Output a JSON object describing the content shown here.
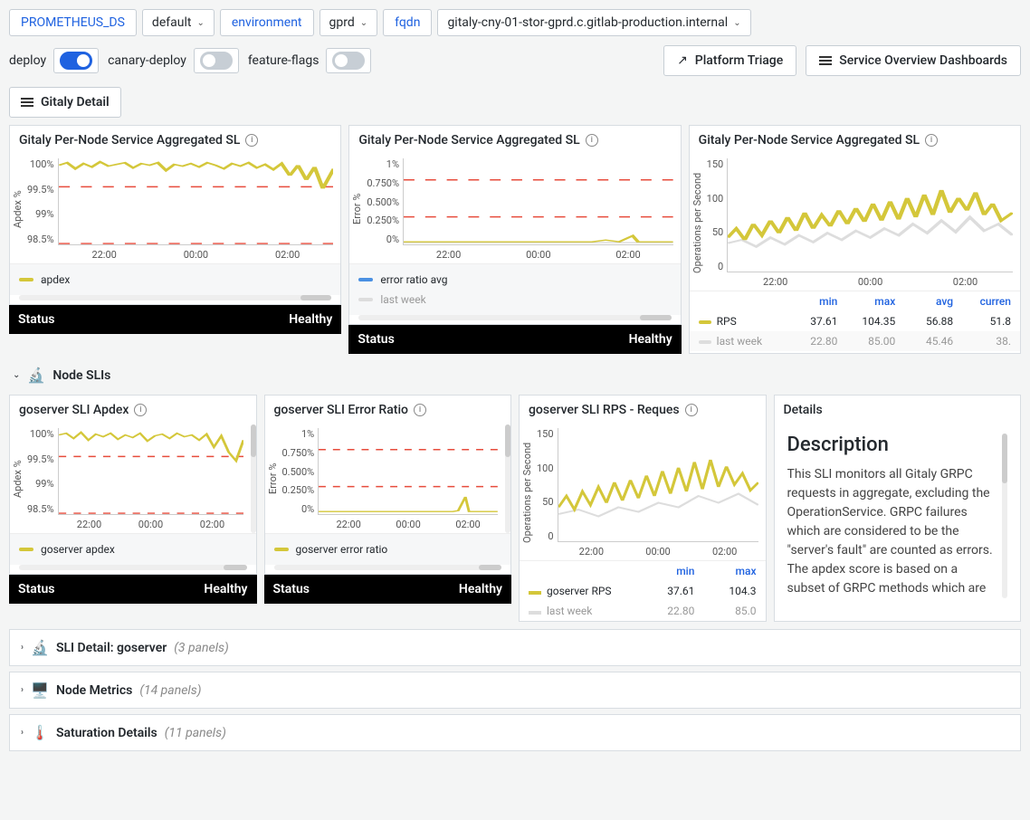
{
  "top_vars": {
    "prometheus_ds_label": "PROMETHEUS_DS",
    "prometheus_ds_value": "default",
    "environment_label": "environment",
    "environment_value": "gprd",
    "fqdn_label": "fqdn",
    "fqdn_value": "gitaly-cny-01-stor-gprd.c.gitlab-production.internal"
  },
  "toggles": {
    "deploy": "deploy",
    "canary_deploy": "canary-deploy",
    "feature_flags": "feature-flags"
  },
  "buttons": {
    "platform_triage": "Platform Triage",
    "service_overview": "Service Overview Dashboards",
    "gitaly_detail": "Gitaly Detail"
  },
  "sections": {
    "node_slis": "Node SLIs"
  },
  "collapsed": [
    {
      "emoji": "🔬",
      "title": "SLI Detail: goserver",
      "count": "(3 panels)"
    },
    {
      "emoji": "🖥️",
      "title": "Node Metrics",
      "count": "(14 panels)"
    },
    {
      "emoji": "🌡️",
      "title": "Saturation Details",
      "count": "(11 panels)"
    }
  ],
  "status": {
    "label": "Status",
    "value": "Healthy"
  },
  "x_ticks": [
    "22:00",
    "00:00",
    "02:00"
  ],
  "colors": {
    "yellow": "#d4c73a",
    "grey": "#cccccc",
    "blue": "#4a90e2",
    "red": "#e74c3c"
  },
  "panels_top": {
    "apdex": {
      "title": "Gitaly Per-Node Service Aggregated SL",
      "y_label": "Apdex %",
      "y_ticks": [
        "100%",
        "99.5%",
        "99%",
        "98.5%"
      ],
      "legend": [
        {
          "color": "yellow",
          "label": "apdex"
        }
      ]
    },
    "error": {
      "title": "Gitaly Per-Node Service Aggregated SL",
      "y_label": "Error %",
      "y_ticks": [
        "1%",
        "0.750%",
        "0.500%",
        "0.250%",
        "0%"
      ],
      "legend": [
        {
          "color": "blue",
          "label": "error ratio avg"
        },
        {
          "color": "grey",
          "label": "last week"
        }
      ]
    },
    "rps": {
      "title": "Gitaly Per-Node Service Aggregated SL",
      "y_label": "Operations per Second",
      "y_ticks": [
        "150",
        "100",
        "50",
        "0"
      ],
      "table_headers": [
        "",
        "min",
        "max",
        "avg",
        "curren"
      ],
      "rows": [
        {
          "color": "yellow",
          "label": "RPS",
          "min": "37.61",
          "max": "104.35",
          "avg": "56.88",
          "cur": "51.8"
        },
        {
          "color": "grey",
          "label": "last week",
          "min": "22.80",
          "max": "85.00",
          "avg": "45.46",
          "cur": "38."
        }
      ]
    }
  },
  "panels_sli": {
    "apdex": {
      "title": "goserver SLI Apdex",
      "y_label": "Apdex %",
      "y_ticks": [
        "100%",
        "99.5%",
        "99%",
        "98.5%"
      ],
      "legend": [
        {
          "color": "yellow",
          "label": "goserver apdex"
        }
      ]
    },
    "error": {
      "title": "goserver SLI Error Ratio",
      "y_label": "Error %",
      "y_ticks": [
        "1%",
        "0.750%",
        "0.500%",
        "0.250%",
        "0%"
      ],
      "legend": [
        {
          "color": "yellow",
          "label": "goserver error ratio"
        }
      ]
    },
    "rps": {
      "title": "goserver SLI RPS - Reques",
      "y_label": "Operations per Second",
      "y_ticks": [
        "150",
        "100",
        "50",
        "0"
      ],
      "table_headers": [
        "",
        "min",
        "max"
      ],
      "rows": [
        {
          "color": "yellow",
          "label": "goserver RPS",
          "min": "37.61",
          "max": "104.3"
        },
        {
          "color": "grey",
          "label": "last week",
          "min": "22.80",
          "max": "85.0"
        }
      ]
    },
    "details": {
      "title": "Details",
      "heading": "Description",
      "body": "This SLI monitors all Gitaly GRPC requests in aggregate, excluding the OperationService. GRPC failures which are considered to be the \"server's fault\" are counted as errors. The apdex score is based on a subset of GRPC methods which are"
    }
  },
  "chart_data": [
    {
      "type": "line",
      "title": "Gitaly Per-Node Service Aggregated Apdex",
      "ylabel": "Apdex %",
      "ylim": [
        98.5,
        100
      ],
      "x": [
        "22:00",
        "00:00",
        "02:00"
      ],
      "series": [
        {
          "name": "apdex",
          "values_approx": "oscillates 99.7-100%, dips ~99.3%"
        }
      ],
      "thresholds": [
        99.5,
        98.5
      ]
    },
    {
      "type": "line",
      "title": "Gitaly Per-Node Service Aggregated Error Ratio",
      "ylabel": "Error %",
      "ylim": [
        0,
        1
      ],
      "x": [
        "22:00",
        "00:00",
        "02:00"
      ],
      "series": [
        {
          "name": "error ratio avg",
          "values_approx": "~0.02%, near zero"
        },
        {
          "name": "last week",
          "values_approx": "~0.02%, near zero"
        }
      ],
      "thresholds": [
        0.75,
        0.3
      ]
    },
    {
      "type": "line",
      "title": "Gitaly Per-Node Service Aggregated RPS",
      "ylabel": "Operations per Second",
      "ylim": [
        0,
        150
      ],
      "x": [
        "22:00",
        "00:00",
        "02:00"
      ],
      "series": [
        {
          "name": "RPS",
          "min": 37.61,
          "max": 104.35,
          "avg": 56.88,
          "current": 51.8
        },
        {
          "name": "last week",
          "min": 22.8,
          "max": 85.0,
          "avg": 45.46,
          "current": 38.0
        }
      ]
    },
    {
      "type": "line",
      "title": "goserver SLI Apdex",
      "ylabel": "Apdex %",
      "ylim": [
        98.5,
        100
      ],
      "x": [
        "22:00",
        "00:00",
        "02:00"
      ],
      "series": [
        {
          "name": "goserver apdex",
          "values_approx": "oscillates 99.7-100%, dips ~99.2%"
        }
      ],
      "thresholds": [
        99.5,
        98.5
      ]
    },
    {
      "type": "line",
      "title": "goserver SLI Error Ratio",
      "ylabel": "Error %",
      "ylim": [
        0,
        1
      ],
      "x": [
        "22:00",
        "00:00",
        "02:00"
      ],
      "series": [
        {
          "name": "goserver error ratio",
          "values_approx": "~0.02%, near zero, small spike ~0.2% near 02:30"
        }
      ],
      "thresholds": [
        0.75,
        0.3
      ]
    },
    {
      "type": "line",
      "title": "goserver SLI RPS",
      "ylabel": "Operations per Second",
      "ylim": [
        0,
        150
      ],
      "x": [
        "22:00",
        "00:00",
        "02:00"
      ],
      "series": [
        {
          "name": "goserver RPS",
          "min": 37.61,
          "max": 104.3
        },
        {
          "name": "last week",
          "min": 22.8,
          "max": 85.0
        }
      ]
    }
  ]
}
